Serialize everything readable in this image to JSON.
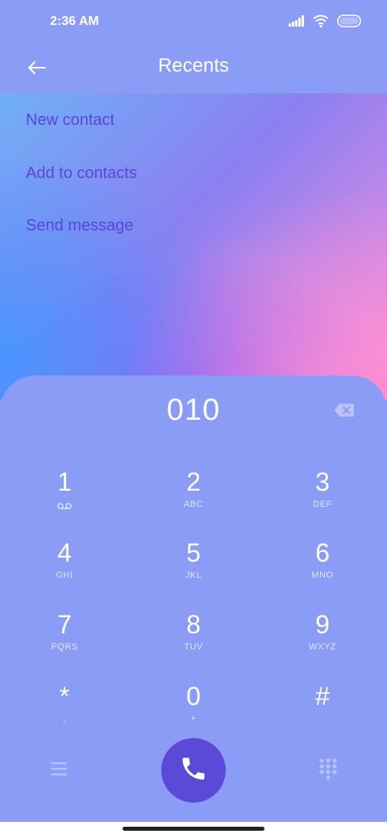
{
  "status_bar": {
    "time": "2:36 AM"
  },
  "header": {
    "title": "Recents"
  },
  "menu": {
    "items": [
      {
        "label": "New contact"
      },
      {
        "label": "Add to contacts"
      },
      {
        "label": "Send message"
      }
    ]
  },
  "dialer": {
    "number": "010",
    "keys": [
      {
        "digit": "1",
        "letters": ""
      },
      {
        "digit": "2",
        "letters": "ABC"
      },
      {
        "digit": "3",
        "letters": "DEF"
      },
      {
        "digit": "4",
        "letters": "GHI"
      },
      {
        "digit": "5",
        "letters": "JKL"
      },
      {
        "digit": "6",
        "letters": "MNO"
      },
      {
        "digit": "7",
        "letters": "PQRS"
      },
      {
        "digit": "8",
        "letters": "TUV"
      },
      {
        "digit": "9",
        "letters": "WXYZ"
      },
      {
        "digit": "*",
        "letters": ","
      },
      {
        "digit": "0",
        "letters": "+"
      },
      {
        "digit": "#",
        "letters": ""
      }
    ]
  },
  "colors": {
    "background": "#8a9cf5",
    "accent": "#5b4ad8",
    "menu_text": "#5a45d8"
  },
  "icons": [
    "back-arrow-icon",
    "signal-icon",
    "wifi-icon",
    "battery-icon",
    "backspace-icon",
    "voicemail-icon",
    "phone-icon",
    "menu-icon",
    "keypad-icon"
  ]
}
